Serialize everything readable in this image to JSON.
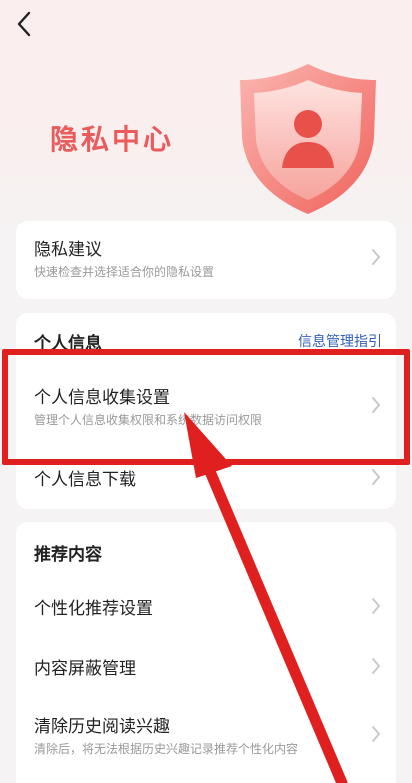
{
  "hero": {
    "title": "隐私中心"
  },
  "privacy_suggestion": {
    "title": "隐私建议",
    "subtitle": "快速检查并选择适合你的隐私设置"
  },
  "personal_info": {
    "section_title": "个人信息",
    "guide_link": "信息管理指引",
    "items": [
      {
        "title": "个人信息收集设置",
        "subtitle": "管理个人信息收集权限和系统数据访问权限"
      },
      {
        "title": "个人信息下载"
      }
    ]
  },
  "recommend": {
    "section_title": "推荐内容",
    "items": [
      {
        "title": "个性化推荐设置"
      },
      {
        "title": "内容屏蔽管理"
      },
      {
        "title": "清除历史阅读兴趣",
        "subtitle": "清除后，将无法根据历史兴趣记录推荐个性化内容"
      }
    ]
  },
  "annotation": {
    "color": "#e0201e"
  },
  "colors": {
    "accent": "#ea5b5b",
    "link": "#3560b8",
    "background": "#f5f3f3"
  }
}
